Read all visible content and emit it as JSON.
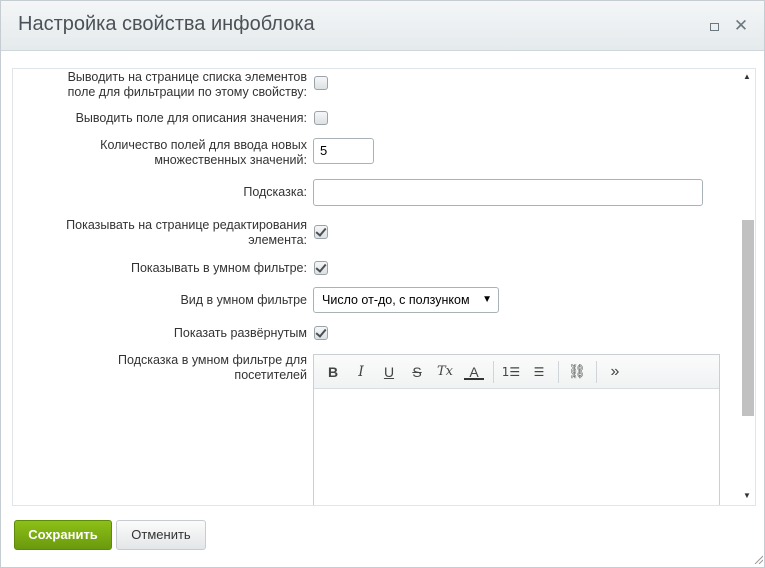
{
  "dialog": {
    "title": "Настройка свойства инфоблока"
  },
  "form": {
    "filter_field_label_1": "Выводить на странице списка элементов",
    "filter_field_label_2": "поле для фильтрации по этому свойству:",
    "filter_field_checked": false,
    "description_label": "Выводить поле для описания значения:",
    "description_checked": false,
    "multiple_count_label_1": "Количество полей для ввода новых",
    "multiple_count_label_2": "множественных значений:",
    "multiple_count_value": "5",
    "hint_label": "Подсказка:",
    "hint_value": "",
    "show_edit_label_1": "Показывать на странице редактирования",
    "show_edit_label_2": "элемента:",
    "show_edit_checked": true,
    "smart_filter_label": "Показывать в умном фильтре:",
    "smart_filter_checked": true,
    "smart_view_label": "Вид в умном фильтре",
    "smart_view_value": "Число от-до, с ползунком",
    "expanded_label": "Показать развёрнутым",
    "expanded_checked": true,
    "smart_hint_label_1": "Подсказка в умном фильтре для",
    "smart_hint_label_2": "посетителей"
  },
  "editor_toolbar": {
    "bold": "B",
    "italic": "I",
    "underline": "U",
    "strike": "S",
    "clear_format": "Tx",
    "font_color": "A",
    "ordered_list": "1☰",
    "unordered_list": "☰",
    "link": "⛓",
    "more": "»"
  },
  "footer": {
    "save_label": "Сохранить",
    "cancel_label": "Отменить"
  },
  "colors": {
    "save_button": "#7aab12",
    "title_text": "#4b5257"
  }
}
